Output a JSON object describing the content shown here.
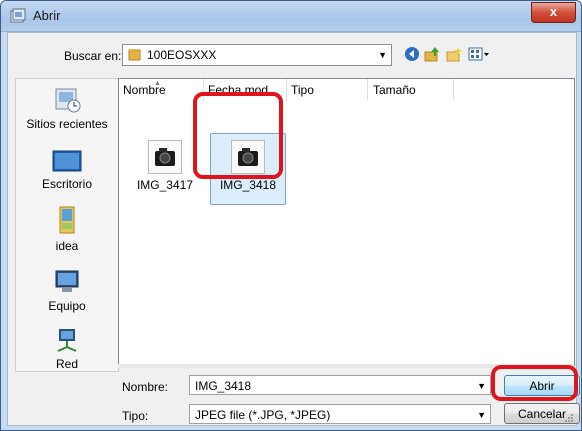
{
  "window": {
    "title": "Abrir",
    "close_label": "x"
  },
  "toolbar": {
    "lookin_label": "Buscar en:",
    "lookin_value": "100EOSXXX"
  },
  "places": [
    {
      "label": "Sitios recientes",
      "icon": "recent-places-icon"
    },
    {
      "label": "Escritorio",
      "icon": "desktop-icon"
    },
    {
      "label": "idea",
      "icon": "user-folder-icon"
    },
    {
      "label": "Equipo",
      "icon": "computer-icon"
    },
    {
      "label": "Red",
      "icon": "network-icon"
    }
  ],
  "columns": [
    "Nombre",
    "Fecha mod...",
    "Tipo",
    "Tamaño"
  ],
  "files": [
    {
      "name": "IMG_3417",
      "selected": false
    },
    {
      "name": "IMG_3418",
      "selected": true
    }
  ],
  "fields": {
    "name_label": "Nombre:",
    "name_value": "IMG_3418",
    "type_label": "Tipo:",
    "type_value": "JPEG file (*.JPG, *JPEG)"
  },
  "buttons": {
    "open": "Abrir",
    "cancel": "Cancelar"
  },
  "colors": {
    "highlight": "#e0141b",
    "selection": "#dceefc",
    "title_bar": "#b3cdeb"
  }
}
